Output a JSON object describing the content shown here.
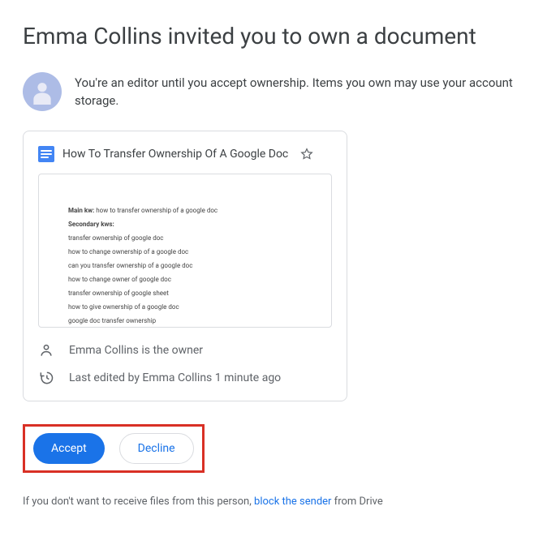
{
  "title": "Emma Collins invited you to own a document",
  "info_text": "You're an editor until you accept ownership. Items you own may use your account storage.",
  "doc": {
    "title": "How To Transfer Ownership Of A Google Doc",
    "preview": {
      "main_kw_label": "Main kw:",
      "main_kw_value": " how to transfer ownership of a google doc",
      "secondary_label": "Secondary kws:",
      "lines": [
        "transfer ownership of google doc",
        "how to change ownership of a google doc",
        "can you transfer ownership of a google doc",
        "how to change owner of google doc",
        "transfer ownership of google sheet",
        "how to give ownership of a google doc",
        "google doc transfer ownership"
      ]
    },
    "owner_text": "Emma Collins is the owner",
    "edited_text": "Last edited by Emma Collins 1 minute ago"
  },
  "buttons": {
    "accept": "Accept",
    "decline": "Decline"
  },
  "footer": {
    "prefix": "If you don't want to receive files from this person, ",
    "link": "block the sender",
    "suffix": " from Drive"
  }
}
